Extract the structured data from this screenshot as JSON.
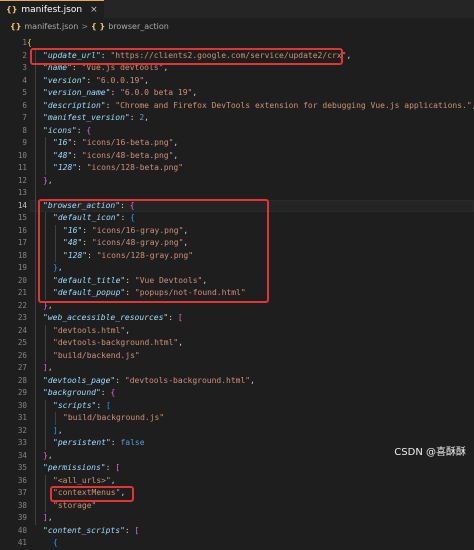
{
  "tab": {
    "icon": "{}",
    "filename": "manifest.json",
    "close": "×"
  },
  "breadcrumb": {
    "file_icon": "{}",
    "file": "manifest.json",
    "sep1": ">",
    "sym_icon": "{ }",
    "symbol": "browser_action"
  },
  "watermark": "CSDN @喜酥酥",
  "active_line": 14,
  "lines": [
    {
      "n": "1",
      "t": [
        [
          "br1",
          "{"
        ]
      ]
    },
    {
      "n": "2",
      "t": [
        [
          "k",
          "\"update_url\""
        ],
        [
          "p",
          ": "
        ],
        [
          "s",
          "\"https://clients2.google.com/service/update2/crx\""
        ],
        [
          "p",
          ","
        ]
      ]
    },
    {
      "n": "3",
      "t": [
        [
          "k",
          "\"name\""
        ],
        [
          "p",
          ": "
        ],
        [
          "s",
          "\"Vue.js devtools\""
        ],
        [
          "p",
          ","
        ]
      ]
    },
    {
      "n": "4",
      "t": [
        [
          "k",
          "\"version\""
        ],
        [
          "p",
          ": "
        ],
        [
          "s",
          "\"6.0.0.19\""
        ],
        [
          "p",
          ","
        ]
      ]
    },
    {
      "n": "5",
      "t": [
        [
          "k",
          "\"version_name\""
        ],
        [
          "p",
          ": "
        ],
        [
          "s",
          "\"6.0.0 beta 19\""
        ],
        [
          "p",
          ","
        ]
      ]
    },
    {
      "n": "6",
      "t": [
        [
          "k",
          "\"description\""
        ],
        [
          "p",
          ": "
        ],
        [
          "s",
          "\"Chrome and Firefox DevTools extension for debugging Vue.js applications.\""
        ],
        [
          "p",
          ","
        ]
      ]
    },
    {
      "n": "7",
      "t": [
        [
          "k",
          "\"manifest_version\""
        ],
        [
          "p",
          ": "
        ],
        [
          "b",
          "2"
        ],
        [
          "p",
          ","
        ]
      ]
    },
    {
      "n": "8",
      "t": [
        [
          "k",
          "\"icons\""
        ],
        [
          "p",
          ": "
        ],
        [
          "br2",
          "{"
        ]
      ]
    },
    {
      "n": "9",
      "t": [
        [
          "k",
          "\"16\""
        ],
        [
          "p",
          ": "
        ],
        [
          "s",
          "\"icons/16-beta.png\""
        ],
        [
          "p",
          ","
        ]
      ]
    },
    {
      "n": "10",
      "t": [
        [
          "k",
          "\"48\""
        ],
        [
          "p",
          ": "
        ],
        [
          "s",
          "\"icons/48-beta.png\""
        ],
        [
          "p",
          ","
        ]
      ]
    },
    {
      "n": "11",
      "t": [
        [
          "k",
          "\"128\""
        ],
        [
          "p",
          ": "
        ],
        [
          "s",
          "\"icons/128-beta.png\""
        ]
      ]
    },
    {
      "n": "12",
      "t": [
        [
          "br2",
          "}"
        ],
        [
          "p",
          ","
        ]
      ]
    },
    {
      "n": "13",
      "t": []
    },
    {
      "n": "14",
      "t": [
        [
          "k",
          "\"browser_action\""
        ],
        [
          "p",
          ": "
        ],
        [
          "br2",
          "{"
        ]
      ]
    },
    {
      "n": "15",
      "t": [
        [
          "k",
          "\"default_icon\""
        ],
        [
          "p",
          ": "
        ],
        [
          "br3",
          "{"
        ]
      ]
    },
    {
      "n": "16",
      "t": [
        [
          "k",
          "\"16\""
        ],
        [
          "p",
          ": "
        ],
        [
          "s",
          "\"icons/16-gray.png\""
        ],
        [
          "p",
          ","
        ]
      ]
    },
    {
      "n": "17",
      "t": [
        [
          "k",
          "\"48\""
        ],
        [
          "p",
          ": "
        ],
        [
          "s",
          "\"icons/48-gray.png\""
        ],
        [
          "p",
          ","
        ]
      ]
    },
    {
      "n": "18",
      "t": [
        [
          "k",
          "\"128\""
        ],
        [
          "p",
          ": "
        ],
        [
          "s",
          "\"icons/128-gray.png\""
        ]
      ]
    },
    {
      "n": "19",
      "t": [
        [
          "br3",
          "}"
        ],
        [
          "p",
          ","
        ]
      ]
    },
    {
      "n": "20",
      "t": [
        [
          "k",
          "\"default_title\""
        ],
        [
          "p",
          ": "
        ],
        [
          "s",
          "\"Vue Devtools\""
        ],
        [
          "p",
          ","
        ]
      ]
    },
    {
      "n": "21",
      "t": [
        [
          "k",
          "\"default_popup\""
        ],
        [
          "p",
          ": "
        ],
        [
          "s",
          "\"popups/not-found.html\""
        ]
      ]
    },
    {
      "n": "22",
      "t": [
        [
          "br2",
          "}"
        ],
        [
          "p",
          ","
        ]
      ]
    },
    {
      "n": "23",
      "t": [
        [
          "k",
          "\"web_accessible_resources\""
        ],
        [
          "p",
          ": "
        ],
        [
          "br2",
          "["
        ]
      ]
    },
    {
      "n": "24",
      "t": [
        [
          "s",
          "\"devtools.html\""
        ],
        [
          "p",
          ","
        ]
      ]
    },
    {
      "n": "25",
      "t": [
        [
          "s",
          "\"devtools-background.html\""
        ],
        [
          "p",
          ","
        ]
      ]
    },
    {
      "n": "26",
      "t": [
        [
          "s",
          "\"build/backend.js\""
        ]
      ]
    },
    {
      "n": "27",
      "t": [
        [
          "br2",
          "]"
        ],
        [
          "p",
          ","
        ]
      ]
    },
    {
      "n": "28",
      "t": [
        [
          "k",
          "\"devtools_page\""
        ],
        [
          "p",
          ": "
        ],
        [
          "s",
          "\"devtools-background.html\""
        ],
        [
          "p",
          ","
        ]
      ]
    },
    {
      "n": "29",
      "t": [
        [
          "k",
          "\"background\""
        ],
        [
          "p",
          ": "
        ],
        [
          "br2",
          "{"
        ]
      ]
    },
    {
      "n": "30",
      "t": [
        [
          "k",
          "\"scripts\""
        ],
        [
          "p",
          ": "
        ],
        [
          "br3",
          "["
        ]
      ]
    },
    {
      "n": "31",
      "t": [
        [
          "s",
          "\"build/background.js\""
        ]
      ]
    },
    {
      "n": "32",
      "t": [
        [
          "br3",
          "]"
        ],
        [
          "p",
          ","
        ]
      ]
    },
    {
      "n": "33",
      "t": [
        [
          "k",
          "\"persistent\""
        ],
        [
          "p",
          ": "
        ],
        [
          "b",
          "false"
        ]
      ]
    },
    {
      "n": "34",
      "t": [
        [
          "br2",
          "}"
        ],
        [
          "p",
          ","
        ]
      ]
    },
    {
      "n": "35",
      "t": [
        [
          "k",
          "\"permissions\""
        ],
        [
          "p",
          ": "
        ],
        [
          "br2",
          "["
        ]
      ]
    },
    {
      "n": "36",
      "t": [
        [
          "s2",
          "\"<all_urls>\""
        ],
        [
          "p",
          ","
        ]
      ]
    },
    {
      "n": "37",
      "t": [
        [
          "s",
          "\"contextMenus\""
        ],
        [
          "p",
          ","
        ]
      ]
    },
    {
      "n": "38",
      "t": [
        [
          "s",
          "\"storage\""
        ]
      ]
    },
    {
      "n": "39",
      "t": [
        [
          "br2",
          "]"
        ],
        [
          "p",
          ","
        ]
      ]
    },
    {
      "n": "40",
      "t": [
        [
          "k",
          "\"content_scripts\""
        ],
        [
          "p",
          ": "
        ],
        [
          "br2",
          "["
        ]
      ]
    },
    {
      "n": "41",
      "t": [
        [
          "br3",
          "{"
        ]
      ]
    }
  ]
}
